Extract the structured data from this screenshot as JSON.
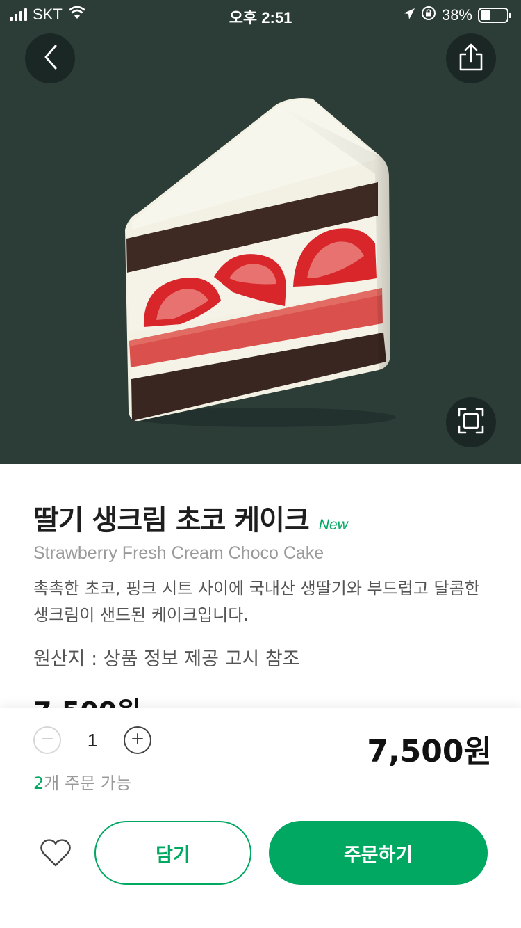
{
  "status_bar": {
    "carrier": "SKT",
    "time": "오후 2:51",
    "battery_text": "38%",
    "battery_level": 0.38
  },
  "icons": {
    "back": "chevron-left-icon",
    "share": "share-icon",
    "expand": "fullscreen-icon",
    "wish": "heart-icon",
    "minus": "minus-icon",
    "plus": "plus-icon"
  },
  "product": {
    "name": "딸기 생크림 초코 케이크",
    "badge": "New",
    "name_en": "Strawberry Fresh Cream Choco Cake",
    "description": "촉촉한 초코, 핑크 시트 사이에 국내산 생딸기와 부드럽고 달콤한 생크림이 샌드된 케이크입니다.",
    "origin": "원산지 : 상품 정보 제공 고시 참조",
    "price": "7,500원"
  },
  "order": {
    "quantity": "1",
    "total_price": "7,500원",
    "available_count": "2",
    "available_suffix": "개 주문 가능",
    "cart_label": "담기",
    "order_label": "주문하기"
  },
  "colors": {
    "brand_green": "#00a862",
    "hero_background": "#2c3d38"
  }
}
